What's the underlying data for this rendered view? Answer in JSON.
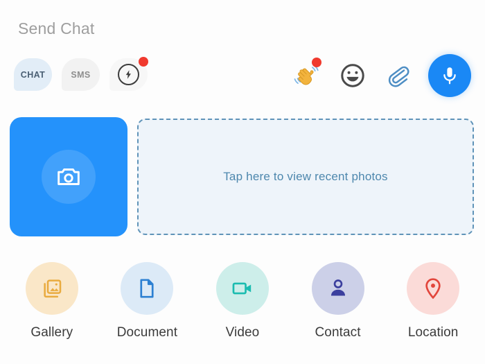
{
  "screen": {
    "title": "Send Chat",
    "background_color": "#fdfdfd"
  },
  "mode_chips": [
    {
      "label": "CHAT",
      "icon": "chat-bubble-icon",
      "bg_color": "#e2edf7",
      "text_color": "#4a5f73",
      "selected": true,
      "badge": false
    },
    {
      "label": "SMS",
      "icon": "sms-bubble-icon",
      "bg_color": "#f2f2f2",
      "text_color": "#8e8e8e",
      "selected": false,
      "badge": false
    },
    {
      "label": "",
      "icon": "flash-bolt-icon",
      "bg_color": "#f7f7f7",
      "text_color": "#3d3d3d",
      "selected": false,
      "badge": true
    }
  ],
  "action_icons": [
    {
      "name": "waving-hand-icon",
      "label": "Wave",
      "badge": true,
      "color": "#f5b544"
    },
    {
      "name": "emoji-smiley-icon",
      "label": "Emoji",
      "badge": false,
      "color": "#4a4a4a"
    },
    {
      "name": "paperclip-icon",
      "label": "Attachment",
      "badge": false,
      "color": "#4e8ec4"
    },
    {
      "name": "microphone-icon",
      "label": "Voice",
      "badge": false,
      "color": "#ffffff",
      "bg_color": "#1a88f5"
    }
  ],
  "camera_tile": {
    "icon": "camera-icon",
    "bg_color": "#2492fb"
  },
  "recent_photos": {
    "label": "Tap here to view recent photos",
    "border_color": "#5f93b8",
    "bg_color": "#eef4fa",
    "text_color": "#4d87ad"
  },
  "shortcuts": [
    {
      "label": "Gallery",
      "icon": "gallery-icon",
      "circle_color": "#fae7c8",
      "icon_color": "#e9ab3f"
    },
    {
      "label": "Document",
      "icon": "document-icon",
      "circle_color": "#dceaf7",
      "icon_color": "#2d80d2"
    },
    {
      "label": "Video",
      "icon": "video-icon",
      "circle_color": "#cdeeea",
      "icon_color": "#1bbcb0"
    },
    {
      "label": "Contact",
      "icon": "contact-icon",
      "circle_color": "#ccd0e8",
      "icon_color": "#3b3f9e"
    },
    {
      "label": "Location",
      "icon": "location-icon",
      "circle_color": "#fbdbd8",
      "icon_color": "#e2463c"
    }
  ],
  "badge_color": "#f03a2e"
}
